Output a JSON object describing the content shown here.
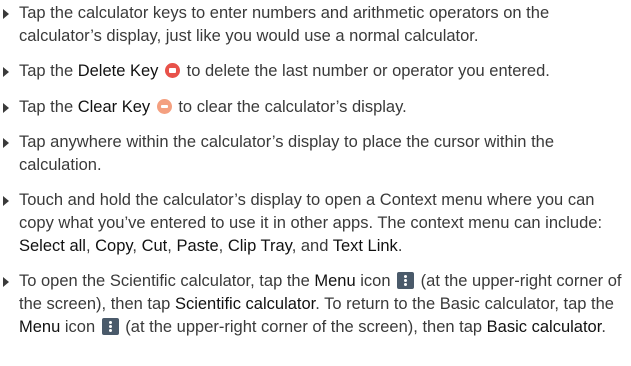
{
  "items": [
    {
      "t1": "Tap the calculator keys to enter numbers and arithmetic operators on the calculator’s display, just like you would use a normal calculator."
    },
    {
      "t1": "Tap the ",
      "k1": "Delete Key",
      "t2": " to delete the last number or operator you entered."
    },
    {
      "t1": "Tap the ",
      "k1": "Clear Key",
      "t2": " to clear the calculator’s display."
    },
    {
      "t1": "Tap anywhere within the calculator’s display to place the cursor within the calculation."
    },
    {
      "t1": "Touch and hold the calculator’s display to open a Context menu where you can copy what you’ve entered to use it in other apps. The context menu can include: ",
      "k1": "Select all",
      "s1": ", ",
      "k2": "Copy",
      "s2": ", ",
      "k3": "Cut",
      "s3": ", ",
      "k4": "Paste",
      "s4": ", ",
      "k5": "Clip Tray",
      "s5": ", and ",
      "k6": "Text Link",
      "s6": "."
    },
    {
      "t1": "To open the Scientific calculator, tap the ",
      "k1": "Menu",
      "t2": " icon ",
      "t3": " (at the upper-right corner of the screen), then tap ",
      "k2": "Scientific calculator",
      "t4": ". To return to the Basic calculator, tap the ",
      "k3": "Menu",
      "t5": " icon ",
      "t6": " (at the upper-right corner of the screen), then tap ",
      "k4": "Basic calculator",
      "t7": "."
    }
  ],
  "icons": {
    "delete": "delete-key-icon",
    "clear": "clear-key-icon",
    "menu": "menu-icon"
  }
}
